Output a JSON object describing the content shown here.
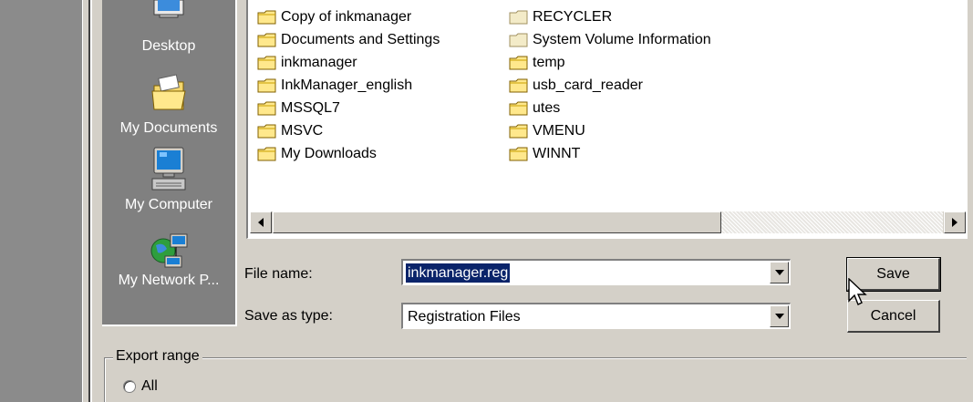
{
  "places": [
    {
      "label": "Desktop",
      "icon": "desktop-icon"
    },
    {
      "label": "My Documents",
      "icon": "my-documents-icon"
    },
    {
      "label": "My Computer",
      "icon": "my-computer-icon"
    },
    {
      "label": "My Network P...",
      "icon": "my-network-places-icon"
    }
  ],
  "files": {
    "col1": [
      "Copy of inkmanager",
      "Documents and Settings",
      "inkmanager",
      "InkManager_english",
      "MSSQL7",
      "MSVC",
      "My Downloads"
    ],
    "col2": [
      "RECYCLER",
      "System Volume Information",
      "temp",
      "usb_card_reader",
      "utes",
      "VMENU",
      "WINNT"
    ]
  },
  "form": {
    "file_name_label": "File name:",
    "file_name_value": "inkmanager.reg",
    "save_as_type_label": "Save as type:",
    "save_as_type_value": "Registration Files"
  },
  "buttons": {
    "save": "Save",
    "cancel": "Cancel"
  },
  "export_range": {
    "title": "Export range",
    "option_all": "All"
  },
  "colors": {
    "selection": "#0a246a",
    "folder_yellow": "#ffe88c",
    "places_bg": "#808080"
  }
}
